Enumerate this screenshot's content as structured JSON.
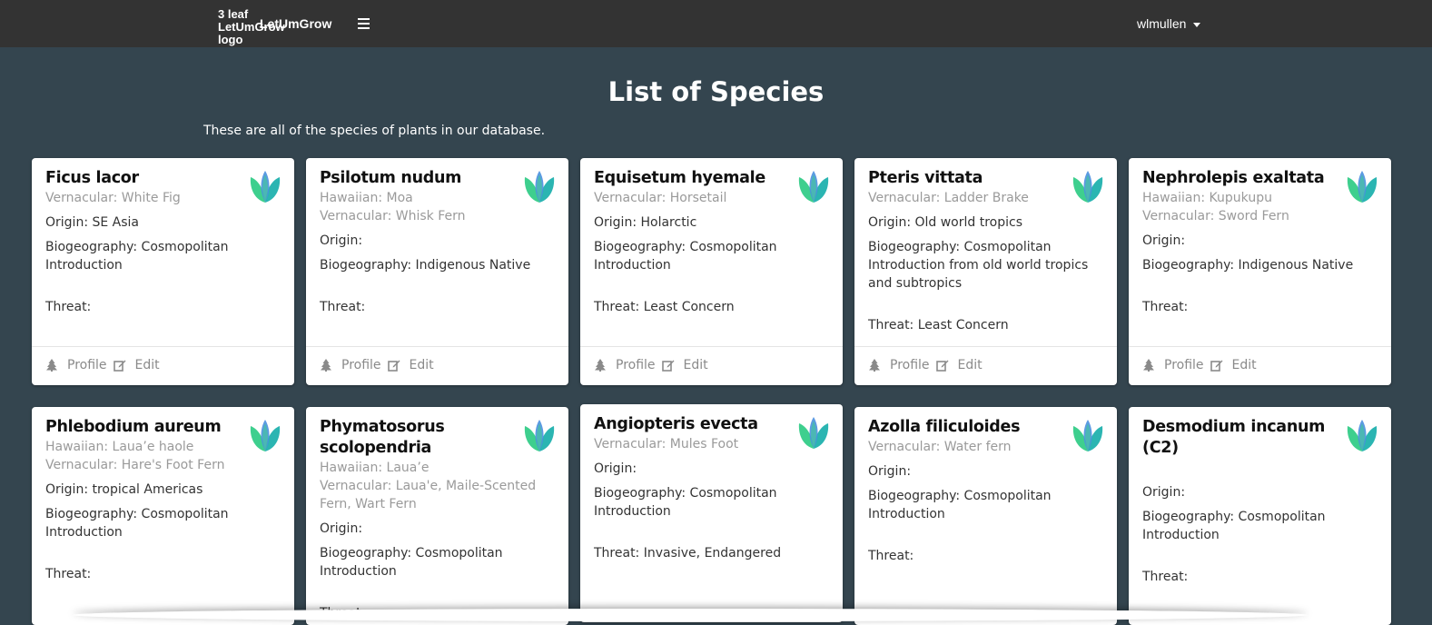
{
  "nav": {
    "logo_alt": "3 leaf LetUmGrow logo",
    "brand": "LetUmGrow",
    "user": "wlmullen"
  },
  "page": {
    "title": "List of Species",
    "subtitle": "These are all of the species of plants in our database."
  },
  "footer_labels": {
    "profile": "Profile",
    "edit": "Edit"
  },
  "icons": {
    "logo": "leaf-logo-icon",
    "menu": "hamburger-menu-icon",
    "profile": "tree-icon",
    "edit": "edit-icon",
    "caret": "caret-down-icon"
  },
  "colors": {
    "navbar": "#333333",
    "background": "#34454f",
    "leaf_green": "#3ecf8e",
    "leaf_teal": "#2bb5b2",
    "leaf_blue": "#4a8fe0"
  },
  "species": [
    {
      "name": "Ficus lacor",
      "hawaiian": "",
      "vernacular": "Vernacular: White Fig",
      "origin": "Origin: SE Asia",
      "biogeography": "Biogeography: Cosmopolitan Introduction",
      "threat": "Threat:"
    },
    {
      "name": "Psilotum nudum",
      "hawaiian": "Hawaiian: Moa",
      "vernacular": "Vernacular: Whisk Fern",
      "origin": "Origin:",
      "biogeography": "Biogeography: Indigenous Native",
      "threat": "Threat:"
    },
    {
      "name": "Equisetum hyemale",
      "hawaiian": "",
      "vernacular": "Vernacular: Horsetail",
      "origin": "Origin: Holarctic",
      "biogeography": "Biogeography: Cosmopolitan Introduction",
      "threat": "Threat: Least Concern"
    },
    {
      "name": "Pteris vittata",
      "hawaiian": "",
      "vernacular": "Vernacular: Ladder Brake",
      "origin": "Origin: Old world tropics",
      "biogeography": "Biogeography: Cosmopolitan Introduction from old world tropics and subtropics",
      "threat": "Threat: Least Concern"
    },
    {
      "name": "Nephrolepis exaltata",
      "hawaiian": "Hawaiian: Kupukupu",
      "vernacular": "Vernacular: Sword Fern",
      "origin": "Origin:",
      "biogeography": "Biogeography: Indigenous Native",
      "threat": "Threat:"
    },
    {
      "name": "Phlebodium aureum",
      "hawaiian": "Hawaiian: Laua’e haole",
      "vernacular": "Vernacular: Hare's Foot Fern",
      "origin": "Origin: tropical Americas",
      "biogeography": "Biogeography: Cosmopolitan Introduction",
      "threat": "Threat:"
    },
    {
      "name": "Phymatosorus scolopendria",
      "hawaiian": "Hawaiian: Laua’e",
      "vernacular": "Vernacular: Laua'e, Maile-Scented Fern, Wart Fern",
      "origin": "Origin:",
      "biogeography": "Biogeography: Cosmopolitan Introduction",
      "threat": "Threat:"
    },
    {
      "name": "Angiopteris evecta",
      "hawaiian": "",
      "vernacular": "Vernacular: Mules Foot",
      "origin": "Origin:",
      "biogeography": "Biogeography: Cosmopolitan Introduction",
      "threat": "Threat: Invasive, Endangered"
    },
    {
      "name": "Azolla filiculoides",
      "hawaiian": "",
      "vernacular": "Vernacular: Water fern",
      "origin": "Origin:",
      "biogeography": "Biogeography: Cosmopolitan Introduction",
      "threat": "Threat:"
    },
    {
      "name": "Desmodium incanum (C2)",
      "hawaiian": "",
      "vernacular": "",
      "origin": "Origin:",
      "biogeography": "Biogeography: Cosmopolitan Introduction",
      "threat": "Threat:"
    }
  ]
}
